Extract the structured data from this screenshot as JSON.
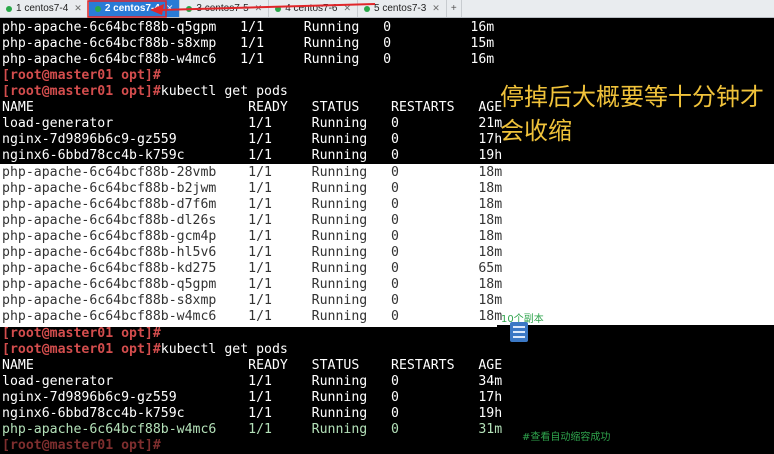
{
  "tabs": [
    {
      "label": "1 centos7-4",
      "active": false
    },
    {
      "label": "2 centos7-4",
      "active": true
    },
    {
      "label": "3 centos7-5",
      "active": false
    },
    {
      "label": "4 centos7-6",
      "active": false
    },
    {
      "label": "5 centos7-3",
      "active": false
    }
  ],
  "tab_new": "+",
  "terminal": {
    "top_rows": [
      "php-apache-6c64bcf88b-q5gpm   1/1     Running   0          16m",
      "php-apache-6c64bcf88b-s8xmp   1/1     Running   0          15m",
      "php-apache-6c64bcf88b-w4mc6   1/1     Running   0          16m"
    ],
    "prompt1": "[root@master01 opt]#",
    "prompt2": "[root@master01 opt]#",
    "cmd2": "kubectl get pods",
    "header": "NAME                           READY   STATUS    RESTARTS   AGE",
    "block1": [
      "load-generator                 1/1     Running   0          21m",
      "nginx-7d9896b6c9-gz559         1/1     Running   0          17h",
      "nginx6-6bbd78cc4b-k759c        1/1     Running   0          19h"
    ],
    "block1_php": [
      "php-apache-6c64bcf88b-28vmb    1/1     Running   0          18m",
      "php-apache-6c64bcf88b-b2jwm    1/1     Running   0          18m",
      "php-apache-6c64bcf88b-d7f6m    1/1     Running   0          18m",
      "php-apache-6c64bcf88b-dl26s    1/1     Running   0          18m",
      "php-apache-6c64bcf88b-gcm4p    1/1     Running   0          18m",
      "php-apache-6c64bcf88b-hl5v6    1/1     Running   0          18m",
      "php-apache-6c64bcf88b-kd275    1/1     Running   0          65m",
      "php-apache-6c64bcf88b-q5gpm    1/1     Running   0          18m",
      "php-apache-6c64bcf88b-s8xmp    1/1     Running   0          18m",
      "php-apache-6c64bcf88b-w4mc6    1/1     Running   0          18m"
    ],
    "prompt3": "[root@master01 opt]#",
    "prompt4": "[root@master01 opt]#",
    "cmd4": "kubectl get pods",
    "header2": "NAME                           READY   STATUS    RESTARTS   AGE",
    "block2": [
      "load-generator                 1/1     Running   0          34m",
      "nginx-7d9896b6c9-gz559         1/1     Running   0          17h",
      "nginx6-6bbd78cc4b-k759c        1/1     Running   0          19h"
    ],
    "block2_php": "php-apache-6c64bcf88b-w4mc6    1/1     Running   0          31m",
    "last_prompt": "[root@master01 opt]#"
  },
  "annotations": {
    "big_note": "停掉后大概要等十分钟才会收缩",
    "replica_note": "10个副本",
    "shrink_note": "#查看自动缩容成功"
  },
  "colors": {
    "tab_active": "#2a7bd6",
    "prompt": "#d34d4d",
    "note_yellow": "#f0c23a",
    "note_green": "#2fa44d",
    "arrow_red": "#e0262a"
  }
}
